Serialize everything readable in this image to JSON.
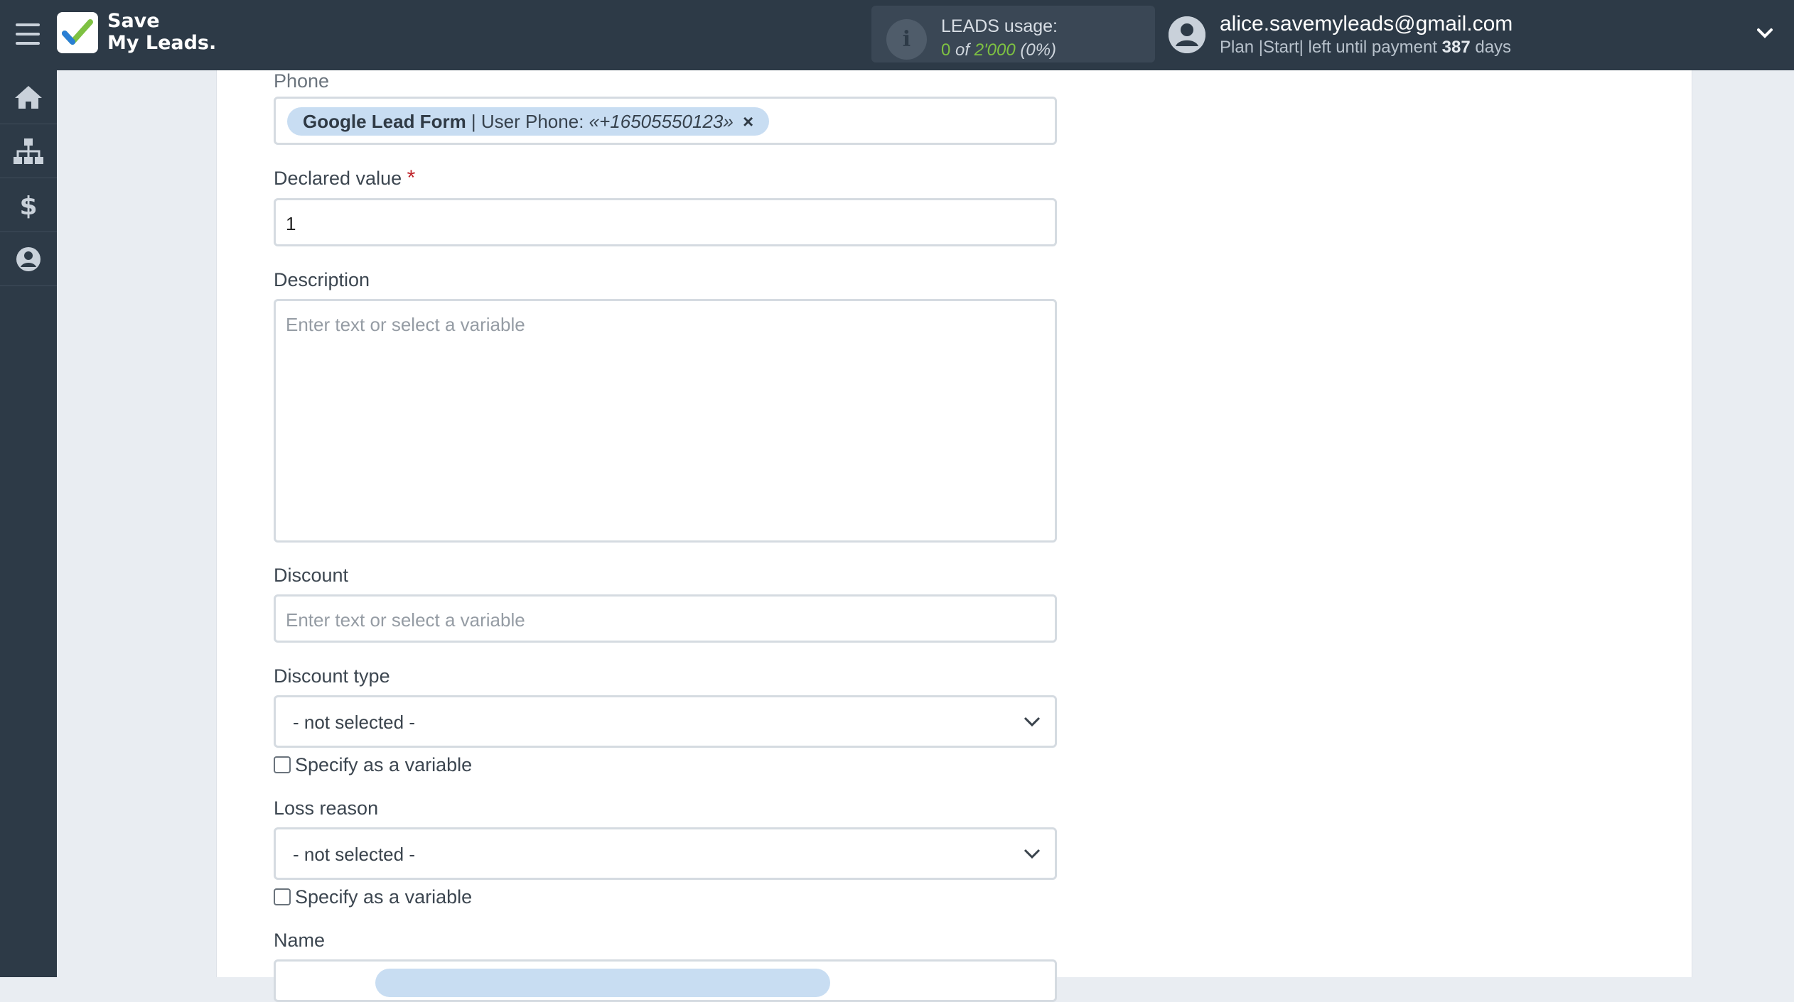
{
  "topbar": {
    "logo_line1": "Save",
    "logo_line2": "My Leads.",
    "usage_label": "LEADS usage:",
    "usage_used": "0",
    "usage_of": "of",
    "usage_total": "2'000",
    "usage_percent": "(0%)",
    "account_email": "alice.savemyleads@gmail.com",
    "plan_prefix": "Plan |Start| left until payment",
    "plan_days": "387",
    "plan_suffix": "days"
  },
  "sidebar": {
    "items": [
      {
        "icon": "home-icon"
      },
      {
        "icon": "sitemap-icon"
      },
      {
        "icon": "dollar-icon"
      },
      {
        "icon": "user-icon"
      }
    ]
  },
  "form": {
    "phone": {
      "label": "Phone",
      "tag_source": "Google Lead Form",
      "tag_sep": " | User Phone: ",
      "tag_value": "«+16505550123»",
      "tag_remove": "×"
    },
    "declared_value": {
      "label": "Declared value",
      "required_mark": "*",
      "value": "1"
    },
    "description": {
      "label": "Description",
      "placeholder": "Enter text or select a variable"
    },
    "discount": {
      "label": "Discount",
      "placeholder": "Enter text or select a variable"
    },
    "discount_type": {
      "label": "Discount type",
      "selected": "- not selected -",
      "checkbox_label": "Specify as a variable"
    },
    "loss_reason": {
      "label": "Loss reason",
      "selected": "- not selected -",
      "checkbox_label": "Specify as a variable"
    },
    "name": {
      "label": "Name"
    }
  },
  "colors": {
    "topbar_bg": "#2d3a47",
    "accent_green": "#7ec142",
    "tag_bg": "#c8ddf2",
    "required_red": "#c0272d"
  }
}
